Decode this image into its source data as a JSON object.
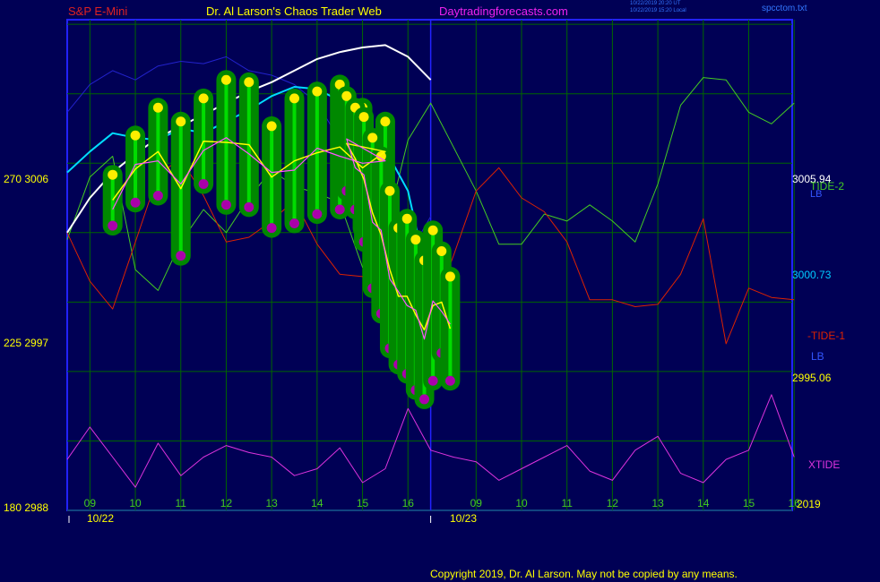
{
  "header": {
    "instrument": "S&P E-Mini",
    "site": "Dr. Al Larson's Chaos Trader Web",
    "url": "Daytradingforecasts.com",
    "stamp_line1": "10/22/2019 20:20 UT",
    "stamp_line2": "10/22/2019 15:20 Local",
    "file": "spcctom.txt"
  },
  "footer": {
    "copyright": "Copyright 2019, Dr. Al Larson. May not be copied by any means."
  },
  "colors": {
    "background": "#000055",
    "frame": "#2222ff",
    "grid": "#006600",
    "price_bar": "#00dd00",
    "glow": "#008800",
    "high_dot": "#ffee00",
    "low_dot": "#aa00aa",
    "ma_fast": "#ffff00",
    "ma_mid": "#ff55ff",
    "ma_cyan": "#00ddff",
    "ma_white": "#ffffff",
    "band": "#2222cc",
    "tide1": "#dd2200",
    "tide2": "#44cc22",
    "xtide": "#dd33dd"
  },
  "chart_data": {
    "type": "line",
    "title": "S&P E-Mini",
    "ylim": [
      2988,
      3009.2
    ],
    "y_ticks": [
      {
        "value": 3006,
        "label": "270  3006"
      },
      {
        "value": 2997,
        "label": "225  2997"
      },
      {
        "value": 2988,
        "label": "180  2988"
      }
    ],
    "x_hour_labels": [
      "09",
      "10",
      "11",
      "12",
      "13",
      "14",
      "15",
      "16",
      "09",
      "10",
      "11",
      "12",
      "13",
      "14",
      "15",
      "16"
    ],
    "x_date_labels": [
      "10/22",
      "10/23"
    ],
    "year_label": "2019",
    "right_labels": {
      "tide2": "TIDE-2",
      "lb_top": "LB",
      "tide1": "-TIDE-1",
      "lb": "LB",
      "xtide": "XTIDE",
      "price1": "3005.94",
      "price2": "3000.73",
      "price3": "2995.06"
    },
    "bar_x": [
      1.0,
      1.5,
      2.0,
      2.5,
      3.0,
      3.5,
      4.0,
      4.5,
      5.0,
      5.5,
      6.0,
      6.5,
      7.0
    ],
    "price_highs": [
      3002.5,
      3004.2,
      3005.4,
      3004.8,
      3005.8,
      3006.6,
      3006.5,
      3004.6,
      3005.8,
      3006.1,
      3006.4,
      3005.4,
      3004.8
    ],
    "price_lows": [
      3000.3,
      3001.3,
      3001.6,
      2999.0,
      3002.1,
      3001.2,
      3001.1,
      3000.2,
      3000.4,
      3000.8,
      3001.0,
      3000.2,
      3002.2
    ],
    "price_highs_pm": [
      3005.9,
      3005.4,
      3005.0,
      3004.1,
      3003.3,
      3001.8,
      3000.2,
      3000.6,
      2999.7,
      2998.8,
      3000.1,
      2999.2,
      2998.1
    ],
    "price_lows_pm": [
      3001.8,
      3001.0,
      2999.6,
      2997.6,
      2996.5,
      2995.0,
      2994.3,
      2993.9,
      2993.2,
      2992.8,
      2993.6,
      2994.8,
      2993.6
    ],
    "series": [
      {
        "name": "TIDE-2",
        "x": [
          0,
          0.5,
          1,
          1.5,
          2,
          2.5,
          3,
          3.5,
          4,
          4.5,
          5,
          5.5,
          6,
          6.5,
          7,
          7.5,
          8,
          8.5,
          9,
          9.5,
          10,
          10.5,
          11,
          11.5,
          12,
          12.5,
          13,
          13.5,
          14,
          14.5,
          15,
          15.5,
          16
        ],
        "y": [
          2999.7,
          3002.4,
          3003.3,
          2998.4,
          2997.5,
          2999.6,
          3001.0,
          3000.0,
          3001.5,
          3002.7,
          3002.0,
          3001.7,
          3001.3,
          2998.5,
          3000.0,
          3004.0,
          3005.6,
          3003.7,
          3001.8,
          2999.5,
          2999.5,
          3000.8,
          3000.5,
          3001.2,
          3000.5,
          2999.6,
          3002.1,
          3005.5,
          3006.7,
          3006.6,
          3005.2,
          3004.7,
          3005.6
        ]
      },
      {
        "name": "-TIDE-1",
        "x": [
          0,
          0.5,
          1,
          1.5,
          2,
          2.5,
          3,
          3.5,
          4,
          4.5,
          5,
          5.5,
          6,
          6.5,
          7,
          7.5,
          8,
          8.5,
          9,
          9.5,
          10,
          10.5,
          11,
          11.5,
          12,
          12.5,
          13,
          13.5,
          14,
          14.5,
          15,
          15.5,
          16
        ],
        "y": [
          3000.0,
          2997.9,
          2996.7,
          2999.6,
          3002.5,
          3003.2,
          3001.6,
          2999.6,
          2999.8,
          3000.5,
          3001.4,
          2999.5,
          2998.2,
          2998.1,
          2997.6,
          2996.1,
          2996.4,
          2999.0,
          3001.8,
          3002.8,
          3001.5,
          3000.9,
          2999.6,
          2997.1,
          2997.1,
          2996.8,
          2996.9,
          2998.2,
          3000.6,
          2995.2,
          2997.6,
          2997.2,
          2997.1
        ]
      },
      {
        "name": "XTIDE",
        "x": [
          0,
          0.5,
          1,
          1.5,
          2,
          2.5,
          3,
          3.5,
          4,
          4.5,
          5,
          5.5,
          6,
          6.5,
          7,
          7.5,
          8,
          8.5,
          9,
          9.5,
          10,
          10.5,
          11,
          11.5,
          12,
          12.5,
          13,
          13.5,
          14,
          14.5,
          15,
          15.5,
          16
        ],
        "y": [
          2990.2,
          2991.6,
          2990.3,
          2989.0,
          2990.9,
          2989.5,
          2990.3,
          2990.8,
          2990.5,
          2990.3,
          2989.5,
          2989.8,
          2990.7,
          2989.2,
          2989.8,
          2992.4,
          2990.6,
          2990.3,
          2990.1,
          2989.3,
          2989.8,
          2990.3,
          2990.8,
          2989.7,
          2989.3,
          2990.6,
          2991.2,
          2989.6,
          2989.2,
          2990.2,
          2990.6,
          2993.0,
          2990.3
        ]
      },
      {
        "name": "LB",
        "x": [
          0,
          0.5,
          1,
          1.5,
          2,
          2.5,
          3,
          3.5,
          4,
          4.5,
          5,
          5.5,
          6,
          6.5,
          7,
          7.5,
          8
        ],
        "y": [
          3005.2,
          3006.4,
          3007.0,
          3006.6,
          3007.2,
          3007.4,
          3007.3,
          3007.6,
          3007.0,
          3006.8,
          3006.4,
          3005.6,
          3004.0,
          3002.3,
          3000.5,
          2999.0,
          3000.7
        ]
      },
      {
        "name": "",
        "x": [
          0,
          0.5,
          1,
          1.5,
          2,
          2.5,
          3,
          3.5,
          4,
          4.5,
          5,
          5.5,
          6,
          6.5,
          7,
          7.5,
          8
        ],
        "y": [
          3000.0,
          3001.5,
          3002.6,
          3003.4,
          3004.1,
          3004.6,
          3005.1,
          3005.6,
          3006.1,
          3006.5,
          3007.0,
          3007.5,
          3007.8,
          3008.0,
          3008.1,
          3007.6,
          3006.6
        ]
      },
      {
        "name": "",
        "x": [
          0,
          0.5,
          1,
          1.5,
          2,
          2.5,
          3,
          3.5,
          4,
          4.5,
          5,
          5.5,
          6,
          6.5,
          7,
          7.5,
          8
        ],
        "y": [
          3002.6,
          3003.5,
          3004.3,
          3004.1,
          3004.0,
          3004.5,
          3004.3,
          3004.8,
          3005.3,
          3005.9,
          3006.3,
          3006.2,
          3005.7,
          3004.4,
          3003.6,
          3001.8,
          2997.4
        ]
      }
    ]
  }
}
